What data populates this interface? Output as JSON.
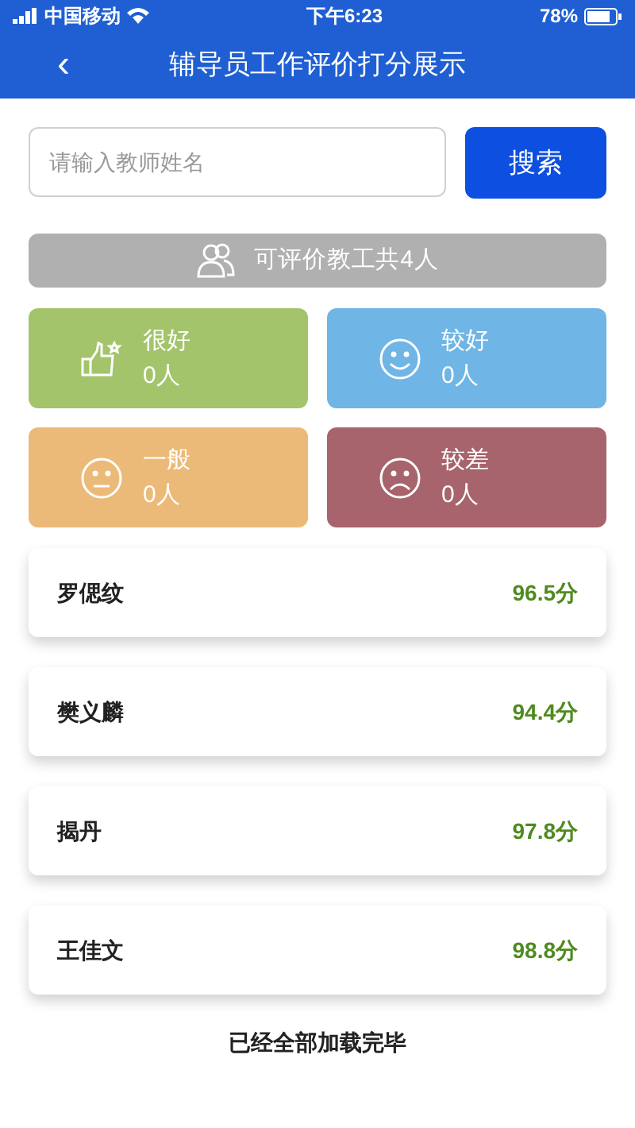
{
  "status_bar": {
    "carrier": "中国移动",
    "time": "下午6:23",
    "battery": "78%"
  },
  "header": {
    "back": "‹",
    "title": "辅导员工作评价打分展示"
  },
  "search": {
    "placeholder": "请输入教师姓名",
    "button": "搜索"
  },
  "summary": "可评价教工共4人",
  "categories": [
    {
      "kind": "thumbs",
      "label": "很好",
      "count": "0人",
      "color": "#a3c46b"
    },
    {
      "kind": "smile",
      "label": "较好",
      "count": "0人",
      "color": "#6fb5e6"
    },
    {
      "kind": "neutral",
      "label": "一般",
      "count": "0人",
      "color": "#ecba78"
    },
    {
      "kind": "sad",
      "label": "较差",
      "count": "0人",
      "color": "#a8646d"
    }
  ],
  "teachers": [
    {
      "name": "罗偲纹",
      "score": "96.5分"
    },
    {
      "name": "樊义麟",
      "score": "94.4分"
    },
    {
      "name": "揭丹",
      "score": "97.8分"
    },
    {
      "name": "王佳文",
      "score": "98.8分"
    }
  ],
  "footer": "已经全部加载完毕"
}
